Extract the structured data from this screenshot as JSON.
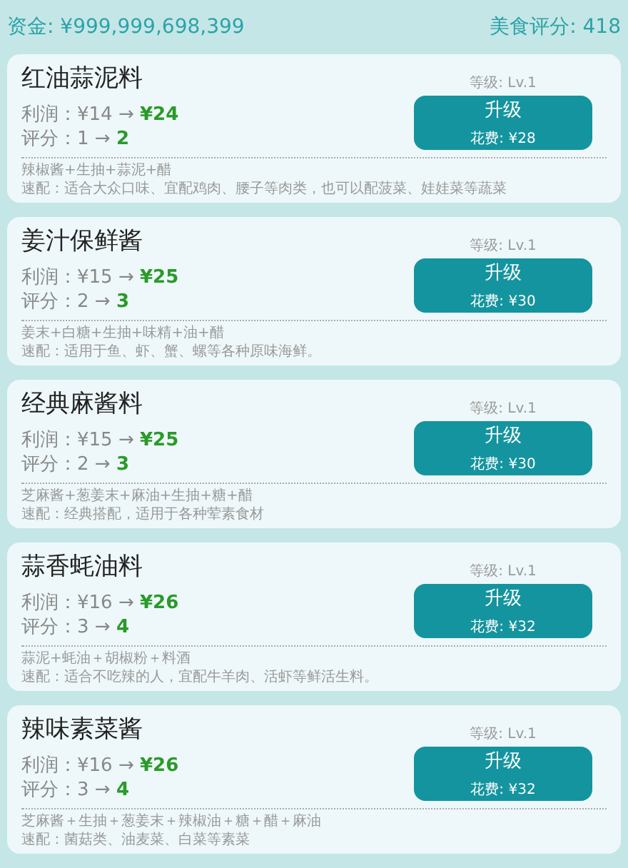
{
  "header": {
    "funds": "资金: ¥999,999,698,399",
    "score": "美食评分: 418"
  },
  "recipes": [
    {
      "name": "红油蒜泥料",
      "profit": "利润：¥14 → **¥24**",
      "rating": "评分：1 → **2**",
      "level": "等级: Lv.1",
      "button": "升级",
      "cost": "花费: ¥28",
      "ingredients": "辣椒酱+生抽+蒜泥+醋",
      "pairing": "速配：适合大众口味、宜配鸡肉、腰子等肉类，也可以配菠菜、娃娃菜等蔬菜"
    },
    {
      "name": "姜汁保鲜酱",
      "profit": "利润：¥15 → **¥25**",
      "rating": "评分：2 → **3**",
      "level": "等级: Lv.1",
      "button": "升级",
      "cost": "花费: ¥30",
      "ingredients": "姜末+白糖+生抽+味精+油+醋",
      "pairing": "速配：适用于鱼、虾、蟹、螺等各种原味海鲜。"
    },
    {
      "name": "经典麻酱料",
      "profit": "利润：¥15 → **¥25**",
      "rating": "评分：2 → **3**",
      "level": "等级: Lv.1",
      "button": "升级",
      "cost": "花费: ¥30",
      "ingredients": "芝麻酱+葱姜末+麻油+生抽+糖+醋",
      "pairing": "速配：经典搭配，适用于各种荤素食材"
    },
    {
      "name": "蒜香蚝油料",
      "profit": "利润：¥16 → **¥26**",
      "rating": "评分：3 → **4**",
      "level": "等级: Lv.1",
      "button": "升级",
      "cost": "花费: ¥32",
      "ingredients": "蒜泥+蚝油＋胡椒粉＋料酒",
      "pairing": "速配：适合不吃辣的人，宜配牛羊肉、活虾等鲜活生料。"
    },
    {
      "name": "辣味素菜酱",
      "profit": "利润：¥16 → **¥26**",
      "rating": "评分：3 → **4**",
      "level": "等级: Lv.1",
      "button": "升级",
      "cost": "花费: ¥32",
      "ingredients": "芝麻酱＋生抽＋葱姜末＋辣椒油＋糖＋醋＋麻油",
      "pairing": "速配：菌菇类、油麦菜、白菜等素菜"
    }
  ]
}
